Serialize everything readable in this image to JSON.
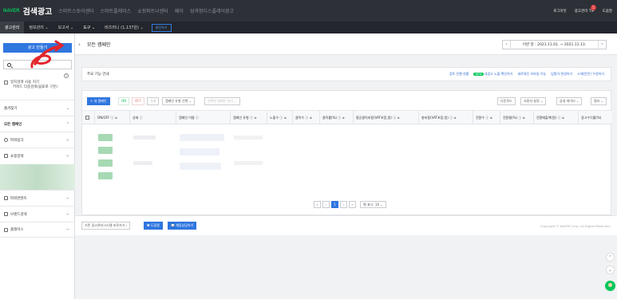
{
  "brand": {
    "naver": "NAVER",
    "title": "검색광고"
  },
  "top_links": [
    "스마트스토어센터",
    "스마트플레이스",
    "쇼핑파트너센터",
    "페이",
    "성과형디스플레이광고"
  ],
  "top_right": {
    "logout": "로그아웃",
    "manager": "광고관리 TIP",
    "help": "도움말",
    "badge": "5"
  },
  "nav": [
    {
      "label": "광고관리"
    },
    {
      "label": "정보관리 ⌄"
    },
    {
      "label": "보고서 ⌄"
    },
    {
      "label": "도구 ⌄"
    },
    {
      "label": "비즈머니 (1,137원) ⌄"
    }
  ],
  "nav_charge": "충전하기",
  "sidebar": {
    "new_button": "광고 만들기",
    "info_icon": "?",
    "checkbox_label_1": "일치검색 사용 허기",
    "checkbox_label_2": "키워드 다중검색(쉼표로 구분)",
    "favorites": "즐겨찾기",
    "all_campaigns": "모든 캠페인",
    "items": [
      {
        "label": "파워링크",
        "icon": "globe-icon",
        "right": "−"
      },
      {
        "label": "쇼핑검색",
        "icon": "bag-icon",
        "right": "−"
      },
      {
        "label": "파워컨텐츠",
        "icon": "doc-icon",
        "right": "−"
      },
      {
        "label": "브랜드검색",
        "icon": "brand-icon",
        "right": "−"
      },
      {
        "label": "플레이스",
        "icon": "place-icon",
        "right": "−"
      }
    ],
    "favorites_right": "⌄",
    "all_right": "⌃"
  },
  "page": {
    "back": "‹",
    "title": "모든 캠페인",
    "date_prev": "‹",
    "date_next": "›",
    "date_label": "이번 달 : 2021.11.01. ~ 2021.11.13."
  },
  "funcbar": {
    "label": "주요 기능 안내",
    "new_badge": "NEW",
    "links": [
      "검토 진행 현황",
      "내광고 노출 확인하기",
      "새로워진 모바일 기능",
      "입찰가 변경하기",
      "소재(문안) 수정하기"
    ]
  },
  "toolbar": {
    "new_campaign": "+ 새 캠페인",
    "on": "ON",
    "off": "OFF",
    "delete": "삭제",
    "type_select": "캠페인 유형 선택 ⌄",
    "manage": "선택한 캠페인 관리 ⌄",
    "download": "다운로드",
    "user_setting": "사용자 설정 ⌄",
    "detail_data": "상세 데이터 ⌄",
    "filter": "필터 ⌄"
  },
  "table": {
    "columns": [
      "ON/OFF ⓘ ≑",
      "상태 ⓘ",
      "캠페인 이름 ⓘ",
      "캠페인 유형 ⓘ ≑",
      "노출수 ⓘ ≑",
      "클릭수 ⓘ ≑",
      "클릭률(%) ⓘ ≑",
      "평균클릭비용(VAT포함,원) ⓘ ≑",
      "총비용(VAT포함,원) ⓘ ≑",
      "전환수 ⓘ ≑",
      "전환율(%) ⓘ ≑",
      "전환매출액(원) ⓘ ≑",
      "광고수익률(%)"
    ]
  },
  "pager": {
    "first": "«",
    "prev": "‹",
    "current": "1",
    "next": "›",
    "last": "»",
    "rows": "행 표시: 10 ⌄"
  },
  "footer": {
    "old_system": "기존 광고관리시스템 보로가기 ›",
    "help": "❶ 도움말",
    "chat": "💬 채팅상담하기",
    "copyright": "Copyright © NAVER Corp. All Rights Reserved."
  },
  "float": {
    "up": "⌃",
    "down": "⌄"
  },
  "colors": {
    "accent": "#2f76df",
    "topbar": "#2d3037",
    "naver_green": "#03c75a"
  }
}
